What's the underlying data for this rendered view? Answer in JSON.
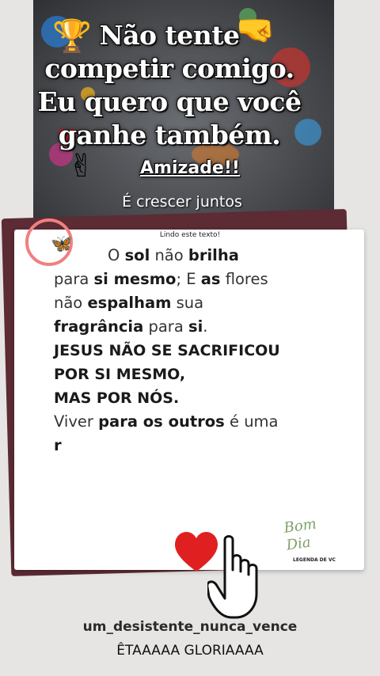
{
  "banner": {
    "headline_lines": [
      "Não tente",
      "competir comigo.",
      "Eu quero que você",
      "ganhe também."
    ],
    "amizade": "Amizade!!",
    "subtitle": "É crescer juntos"
  },
  "note": {
    "header": "Lindo este texto!",
    "signature": "Bom Dia",
    "stamp": "LEGENDA DE VC"
  },
  "text": {
    "l1_a": "O ",
    "l1_b": "sol",
    "l1_c": " não ",
    "l1_d": "brilha",
    "l2_a": "para ",
    "l2_b": "si mesmo",
    "l2_c": "; E ",
    "l2_d": "as",
    "l2_e": " flores",
    "l3_a": "não ",
    "l3_b": "espalham",
    "l3_c": " sua",
    "l4_a": "fragrância",
    "l4_b": " para ",
    "l4_c": "si",
    "l4_d": ".",
    "l5": "JESUS NÃO SE SACRIFICOU",
    "l6": "POR SI MESMO,",
    "l7": "MAS POR NÓS.",
    "l8_a": "Viver ",
    "l8_b": "para os outros",
    "l8_c": " é uma",
    "l9": "r"
  },
  "footer": {
    "username": "um_desistente_nunca_vence",
    "sound": "ÊTAAAAA GLORIAAAA"
  },
  "icons": {
    "trophy": "trophy-icon",
    "fist_bump": "fist-bump-icon",
    "heart_small": "heart-icon",
    "victory_hand": "victory-hand-icon",
    "butterfly": "butterfly-icon",
    "big_heart": "heart-icon",
    "pointing_hand": "pointing-hand-icon"
  },
  "colors": {
    "back_paper": "#5c2b34",
    "heart_red": "#e02020",
    "pin_pink": "#f08080"
  }
}
